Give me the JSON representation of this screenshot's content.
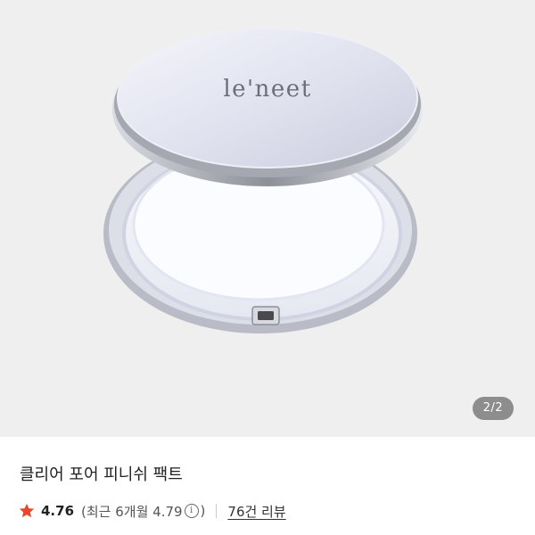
{
  "gallery": {
    "brand_logo": "le'neet",
    "page_indicator": "2/2",
    "current_page": 2,
    "total_pages": 2
  },
  "product": {
    "title": "클리어 포어 피니쉬 팩트",
    "rating": "4.76",
    "recent_rating_prefix": "(최근 6개월 4.79",
    "recent_rating_suffix": ")",
    "review_count_link": "76건 리뷰"
  },
  "icons": {
    "rating": "star-icon",
    "info": "info-icon"
  },
  "colors": {
    "star": "#e8472f",
    "gallery_bg": "#efefef"
  }
}
